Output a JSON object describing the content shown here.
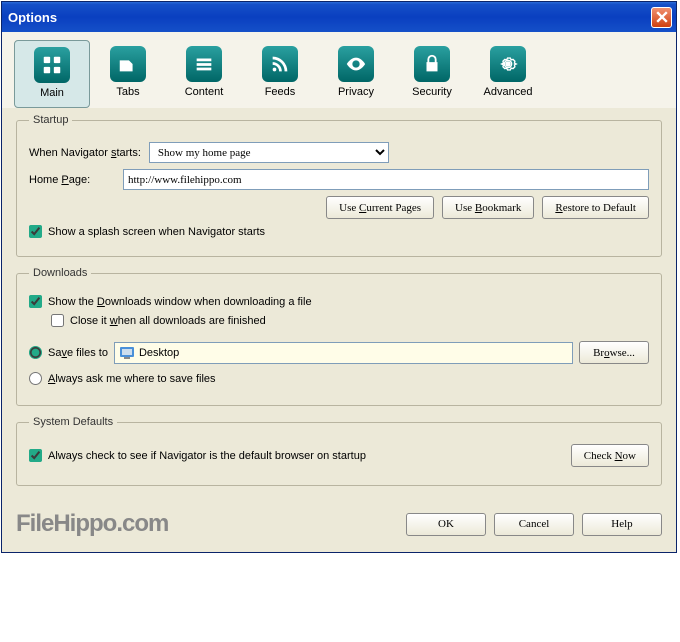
{
  "title": "Options",
  "tabs": [
    {
      "label": "Main",
      "icon": "grid"
    },
    {
      "label": "Tabs",
      "icon": "tab"
    },
    {
      "label": "Content",
      "icon": "stack"
    },
    {
      "label": "Feeds",
      "icon": "rss"
    },
    {
      "label": "Privacy",
      "icon": "eye"
    },
    {
      "label": "Security",
      "icon": "lock"
    },
    {
      "label": "Advanced",
      "icon": "gear"
    }
  ],
  "startup": {
    "legend": "Startup",
    "when_starts_lbl": "When Navigator starts:",
    "when_starts_value": "Show my home page",
    "home_lbl": "Home Page:",
    "home_value": "http://www.filehippo.com",
    "use_current": "Use Current Pages",
    "use_bookmark": "Use Bookmark",
    "restore": "Restore to Default",
    "splash": "Show a splash screen when Navigator starts"
  },
  "downloads": {
    "legend": "Downloads",
    "show_dl": "Show the Downloads window when downloading a file",
    "close_it": "Close it when all downloads are finished",
    "save_to": "Save files to",
    "path": "Desktop",
    "browse": "Browse...",
    "ask": "Always ask me where to save files"
  },
  "defaults": {
    "legend": "System Defaults",
    "check": "Always check to see if Navigator is the default browser on startup",
    "check_now": "Check Now"
  },
  "buttons": {
    "ok": "OK",
    "cancel": "Cancel",
    "help": "Help"
  },
  "watermark": "FileHippo.com"
}
